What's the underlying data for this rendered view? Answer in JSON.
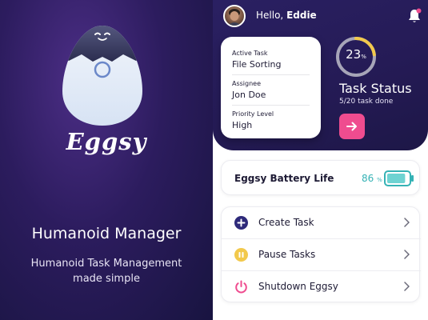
{
  "splash": {
    "brand": "Eggsy",
    "headline": "Humanoid Manager",
    "tagline_line1": "Humanoid Task Management",
    "tagline_line2": "made simple"
  },
  "header": {
    "greeting_prefix": "Hello,",
    "user_name": "Eddie"
  },
  "task": {
    "active_task_label": "Active Task",
    "active_task_value": "File Sorting",
    "assignee_label": "Assignee",
    "assignee_value": "Jon Doe",
    "priority_label": "Priority Level",
    "priority_value": "High"
  },
  "status": {
    "percent": "23",
    "percent_unit": "%",
    "progress_fraction": 0.23,
    "title": "Task Status",
    "subtitle": "5/20 task done"
  },
  "battery": {
    "label": "Eggsy Battery Life",
    "percent": "86",
    "percent_unit": "%",
    "level_fraction": 0.86
  },
  "menu": {
    "items": [
      {
        "label": "Create Task",
        "icon": "plus-circle-icon"
      },
      {
        "label": "Pause Tasks",
        "icon": "pause-circle-icon"
      },
      {
        "label": "Shutdown Eggsy",
        "icon": "power-icon"
      }
    ]
  },
  "colors": {
    "primary_purple": "#2a2062",
    "accent_pink": "#ef4c8f",
    "accent_yellow": "#f2c94c",
    "accent_teal": "#35b2b5",
    "menu_create": "#2e2a7a",
    "menu_pause": "#f2c94c",
    "menu_shutdown": "#ef4c8f"
  }
}
